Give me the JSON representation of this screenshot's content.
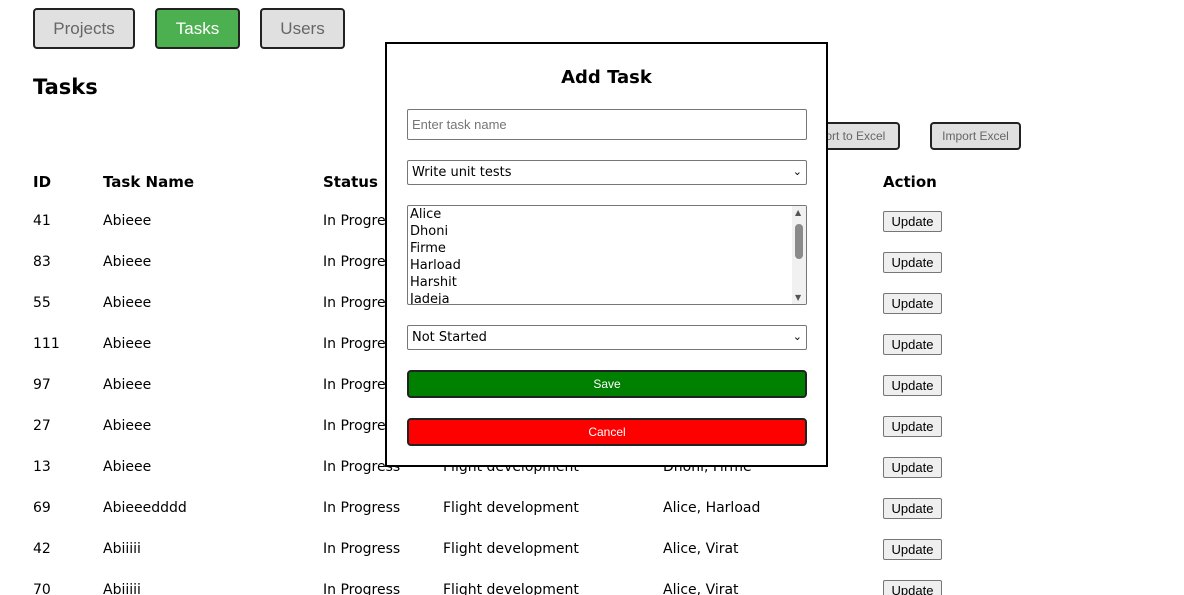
{
  "nav": {
    "projects": "Projects",
    "tasks": "Tasks",
    "users": "Users"
  },
  "page_title": "Tasks",
  "toolbar": {
    "export_label": "Export to Excel",
    "import_label": "Import Excel"
  },
  "table": {
    "headers": {
      "id": "ID",
      "task_name": "Task Name",
      "status": "Status",
      "action": "Action"
    },
    "update_label": "Update",
    "rows": [
      {
        "id": "41",
        "name": "Abieee",
        "status": "In Progress",
        "project": "",
        "users": ""
      },
      {
        "id": "83",
        "name": "Abieee",
        "status": "In Progress",
        "project": "",
        "users": ""
      },
      {
        "id": "55",
        "name": "Abieee",
        "status": "In Progress",
        "project": "",
        "users": ""
      },
      {
        "id": "111",
        "name": "Abieee",
        "status": "In Progress",
        "project": "",
        "users": ""
      },
      {
        "id": "97",
        "name": "Abieee",
        "status": "In Progress",
        "project": "",
        "users": ""
      },
      {
        "id": "27",
        "name": "Abieee",
        "status": "In Progress",
        "project": "",
        "users": ""
      },
      {
        "id": "13",
        "name": "Abieee",
        "status": "In Progress",
        "project": "Flight development",
        "users": "Dhoni, Firme"
      },
      {
        "id": "69",
        "name": "Abieeedddd",
        "status": "In Progress",
        "project": "Flight development",
        "users": "Alice, Harload"
      },
      {
        "id": "42",
        "name": "Abiiiii",
        "status": "In Progress",
        "project": "Flight development",
        "users": "Alice, Virat"
      },
      {
        "id": "70",
        "name": "Abiiiii",
        "status": "In Progress",
        "project": "Flight development",
        "users": "Alice, Virat"
      }
    ]
  },
  "modal": {
    "title": "Add Task",
    "task_name_placeholder": "Enter task name",
    "project_selected": "Write unit tests",
    "users_options": [
      "Alice",
      "Dhoni",
      "Firme",
      "Harload",
      "Harshit",
      "Jadeja"
    ],
    "status_selected": "Not Started",
    "save_label": "Save",
    "cancel_label": "Cancel",
    "colors": {
      "save": "#008000",
      "cancel": "#ff0000"
    }
  },
  "colors": {
    "active_nav": "#4caf50",
    "inactive_nav": "#e0e0e0"
  }
}
